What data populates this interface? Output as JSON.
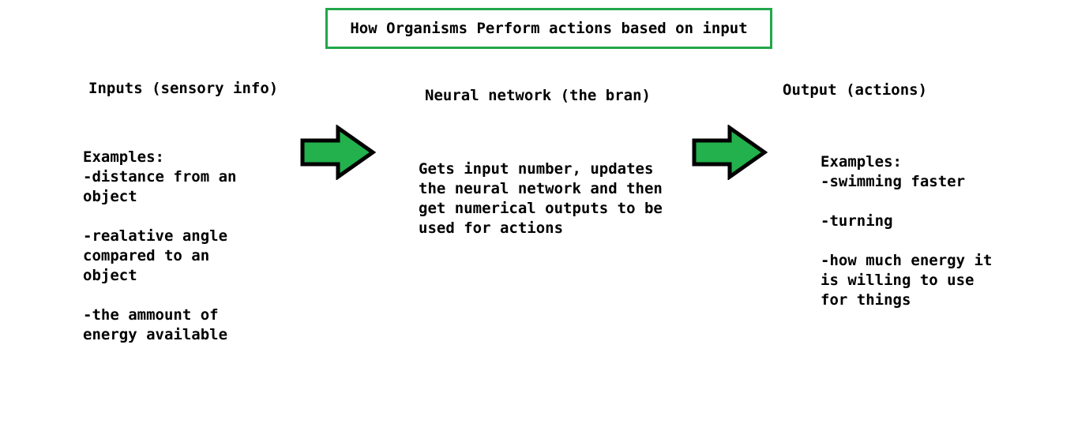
{
  "title": "How Organisms Perform actions based on input",
  "colors": {
    "accent": "#22a74a",
    "arrow_fill": "#22b14c",
    "arrow_stroke": "#000000"
  },
  "columns": {
    "inputs": {
      "heading": "Inputs (sensory info)",
      "text": "Examples:\n-distance from an\nobject\n\n-realative angle\ncompared to an\nobject\n\n-the ammount of\nenergy available"
    },
    "network": {
      "heading": "Neural network (the bran)",
      "text": "Gets input number, updates\nthe neural network and then\nget numerical outputs to be\nused for actions"
    },
    "output": {
      "heading": "Output (actions)",
      "text": "Examples:\n-swimming faster\n\n-turning\n\n-how much energy it\nis willing to use\nfor things"
    }
  },
  "arrows": [
    {
      "name": "arrow-inputs-to-network",
      "icon": "right-arrow-icon"
    },
    {
      "name": "arrow-network-to-output",
      "icon": "right-arrow-icon"
    }
  ]
}
